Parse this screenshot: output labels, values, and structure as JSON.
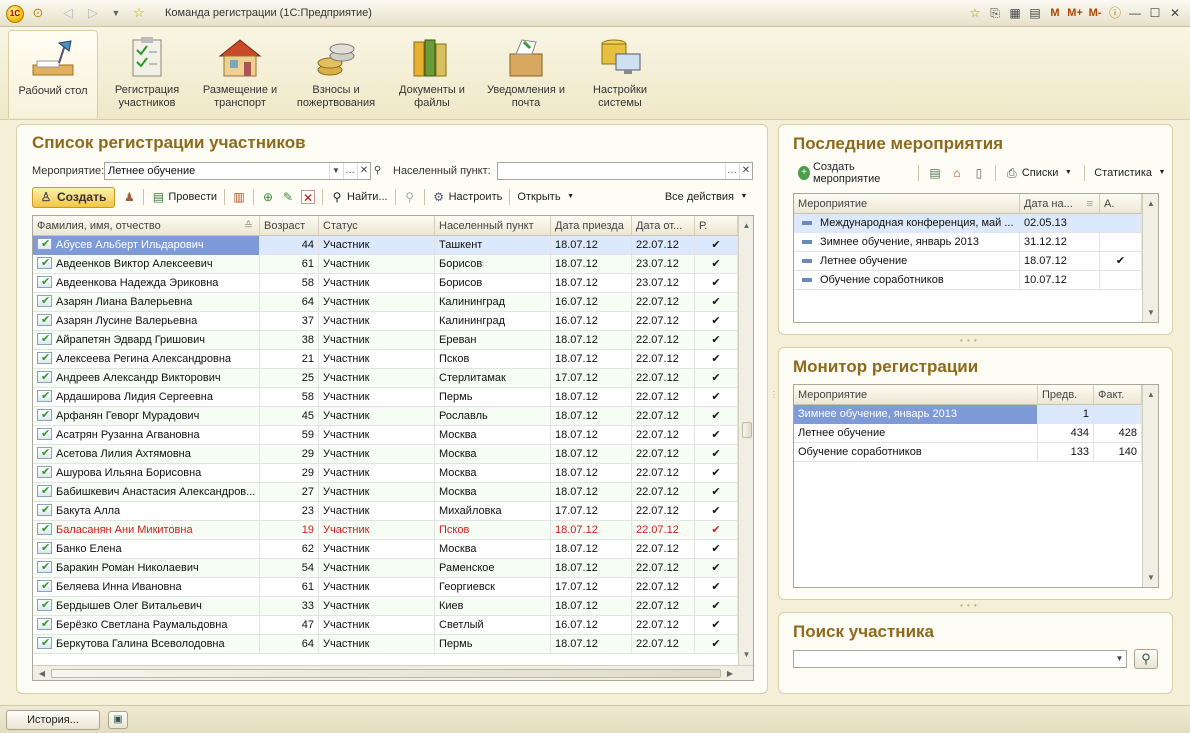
{
  "window": {
    "title": "Команда регистрации  (1С:Предприятие)",
    "logo": "1С",
    "right_tools": [
      "M",
      "M+",
      "M-"
    ]
  },
  "sections": [
    {
      "label": "Рабочий стол",
      "icon": "desk-lamp-icon"
    },
    {
      "label": "Регистрация участников",
      "icon": "clipboard-checklist-icon"
    },
    {
      "label": "Размещение и транспорт",
      "icon": "house-icon"
    },
    {
      "label": "Взносы и пожертвования",
      "icon": "coins-icon"
    },
    {
      "label": "Документы и файлы",
      "icon": "folders-icon"
    },
    {
      "label": "Уведомления и почта",
      "icon": "mail-box-icon"
    },
    {
      "label": "Настройки системы",
      "icon": "computer-database-icon"
    }
  ],
  "registration": {
    "title": "Список регистрации участников",
    "event_label": "Мероприятие:",
    "event_value": "Летнее обучение",
    "city_label": "Населенный пункт:",
    "city_value": "",
    "toolbar": {
      "create": "Создать",
      "post": "Провести",
      "find": "Найти...",
      "configure": "Настроить",
      "open": "Открыть",
      "all_actions": "Все действия"
    },
    "columns": [
      "Фамилия, имя, отчество",
      "Возраст",
      "Статус",
      "Населенный пункт",
      "Дата приезда",
      "Дата от...",
      "Р."
    ],
    "rows": [
      {
        "name": "Абусев Альберт Ильдарович",
        "age": "44",
        "status": "Участник",
        "city": "Ташкент",
        "arrive": "18.07.12",
        "depart": "22.07.12",
        "r": "✔"
      },
      {
        "name": "Авдеенков Виктор Алексеевич",
        "age": "61",
        "status": "Участник",
        "city": "Борисов",
        "arrive": "18.07.12",
        "depart": "23.07.12",
        "r": "✔"
      },
      {
        "name": "Авдеенкова Надежда Эриковна",
        "age": "58",
        "status": "Участник",
        "city": "Борисов",
        "arrive": "18.07.12",
        "depart": "23.07.12",
        "r": "✔"
      },
      {
        "name": "Азарян Лиана Валерьевна",
        "age": "64",
        "status": "Участник",
        "city": "Калининград",
        "arrive": "16.07.12",
        "depart": "22.07.12",
        "r": "✔"
      },
      {
        "name": "Азарян Лусине Валерьевна",
        "age": "37",
        "status": "Участник",
        "city": "Калининград",
        "arrive": "16.07.12",
        "depart": "22.07.12",
        "r": "✔"
      },
      {
        "name": "Айрапетян Эдвард Гришович",
        "age": "38",
        "status": "Участник",
        "city": "Ереван",
        "arrive": "18.07.12",
        "depart": "22.07.12",
        "r": "✔"
      },
      {
        "name": "Алексеева Регина Александровна",
        "age": "21",
        "status": "Участник",
        "city": "Псков",
        "arrive": "18.07.12",
        "depart": "22.07.12",
        "r": "✔"
      },
      {
        "name": "Андреев Александр Викторович",
        "age": "25",
        "status": "Участник",
        "city": "Стерлитамак",
        "arrive": "17.07.12",
        "depart": "22.07.12",
        "r": "✔"
      },
      {
        "name": "Ардаширова Лидия Сергеевна",
        "age": "58",
        "status": "Участник",
        "city": "Пермь",
        "arrive": "18.07.12",
        "depart": "22.07.12",
        "r": "✔"
      },
      {
        "name": "Арфанян Геворг Мурадович",
        "age": "45",
        "status": "Участник",
        "city": "Рославль",
        "arrive": "18.07.12",
        "depart": "22.07.12",
        "r": "✔"
      },
      {
        "name": "Асатрян Рузанна Агвановна",
        "age": "59",
        "status": "Участник",
        "city": "Москва",
        "arrive": "18.07.12",
        "depart": "22.07.12",
        "r": "✔"
      },
      {
        "name": "Асетова Лилия Ахтямовна",
        "age": "29",
        "status": "Участник",
        "city": "Москва",
        "arrive": "18.07.12",
        "depart": "22.07.12",
        "r": "✔"
      },
      {
        "name": "Ашурова Ильяна Борисовна",
        "age": "29",
        "status": "Участник",
        "city": "Москва",
        "arrive": "18.07.12",
        "depart": "22.07.12",
        "r": "✔"
      },
      {
        "name": "Бабишкевич Анастасия Александров...",
        "age": "27",
        "status": "Участник",
        "city": "Москва",
        "arrive": "18.07.12",
        "depart": "22.07.12",
        "r": "✔"
      },
      {
        "name": "Бакута Алла",
        "age": "23",
        "status": "Участник",
        "city": "Михайловка",
        "arrive": "17.07.12",
        "depart": "22.07.12",
        "r": "✔"
      },
      {
        "name": "Баласанян Ани Микитовна",
        "age": "19",
        "status": "Участник",
        "city": "Псков",
        "arrive": "18.07.12",
        "depart": "22.07.12",
        "r": "✔"
      },
      {
        "name": "Банко Елена",
        "age": "62",
        "status": "Участник",
        "city": "Москва",
        "arrive": "18.07.12",
        "depart": "22.07.12",
        "r": "✔"
      },
      {
        "name": "Баракин Роман Николаевич",
        "age": "54",
        "status": "Участник",
        "city": "Раменское",
        "arrive": "18.07.12",
        "depart": "22.07.12",
        "r": "✔"
      },
      {
        "name": "Беляева Инна Ивановна",
        "age": "61",
        "status": "Участник",
        "city": "Георгиевск",
        "arrive": "17.07.12",
        "depart": "22.07.12",
        "r": "✔"
      },
      {
        "name": "Бердышев Олег Витальевич",
        "age": "33",
        "status": "Участник",
        "city": "Киев",
        "arrive": "18.07.12",
        "depart": "22.07.12",
        "r": "✔"
      },
      {
        "name": "Берёзко Светлана Раумальдовна",
        "age": "47",
        "status": "Участник",
        "city": "Светлый",
        "arrive": "16.07.12",
        "depart": "22.07.12",
        "r": "✔"
      },
      {
        "name": "Беркутова Галина Всеволодовна",
        "age": "64",
        "status": "Участник",
        "city": "Пермь",
        "arrive": "18.07.12",
        "depart": "22.07.12",
        "r": "✔"
      }
    ]
  },
  "events": {
    "title": "Последние мероприятия",
    "toolbar": {
      "create": "Создать мероприятие",
      "lists": "Списки",
      "stats": "Статистика"
    },
    "columns": [
      "Мероприятие",
      "Дата на...",
      "А."
    ],
    "rows": [
      {
        "name": "Международная конференция, май ...",
        "date": "02.05.13",
        "a": ""
      },
      {
        "name": "Зимнее обучение, январь 2013",
        "date": "31.12.12",
        "a": ""
      },
      {
        "name": "Летнее обучение",
        "date": "18.07.12",
        "a": "✔"
      },
      {
        "name": "Обучение соработников",
        "date": "10.07.12",
        "a": ""
      }
    ]
  },
  "monitor": {
    "title": "Монитор регистрации",
    "columns": [
      "Мероприятие",
      "Предв.",
      "Факт."
    ],
    "rows": [
      {
        "name": "Зимнее обучение, январь 2013",
        "pre": "1",
        "fact": ""
      },
      {
        "name": "Летнее обучение",
        "pre": "434",
        "fact": "428"
      },
      {
        "name": "Обучение соработников",
        "pre": "133",
        "fact": "140"
      }
    ]
  },
  "search": {
    "title": "Поиск участника",
    "value": ""
  },
  "bottom": {
    "history": "История..."
  }
}
